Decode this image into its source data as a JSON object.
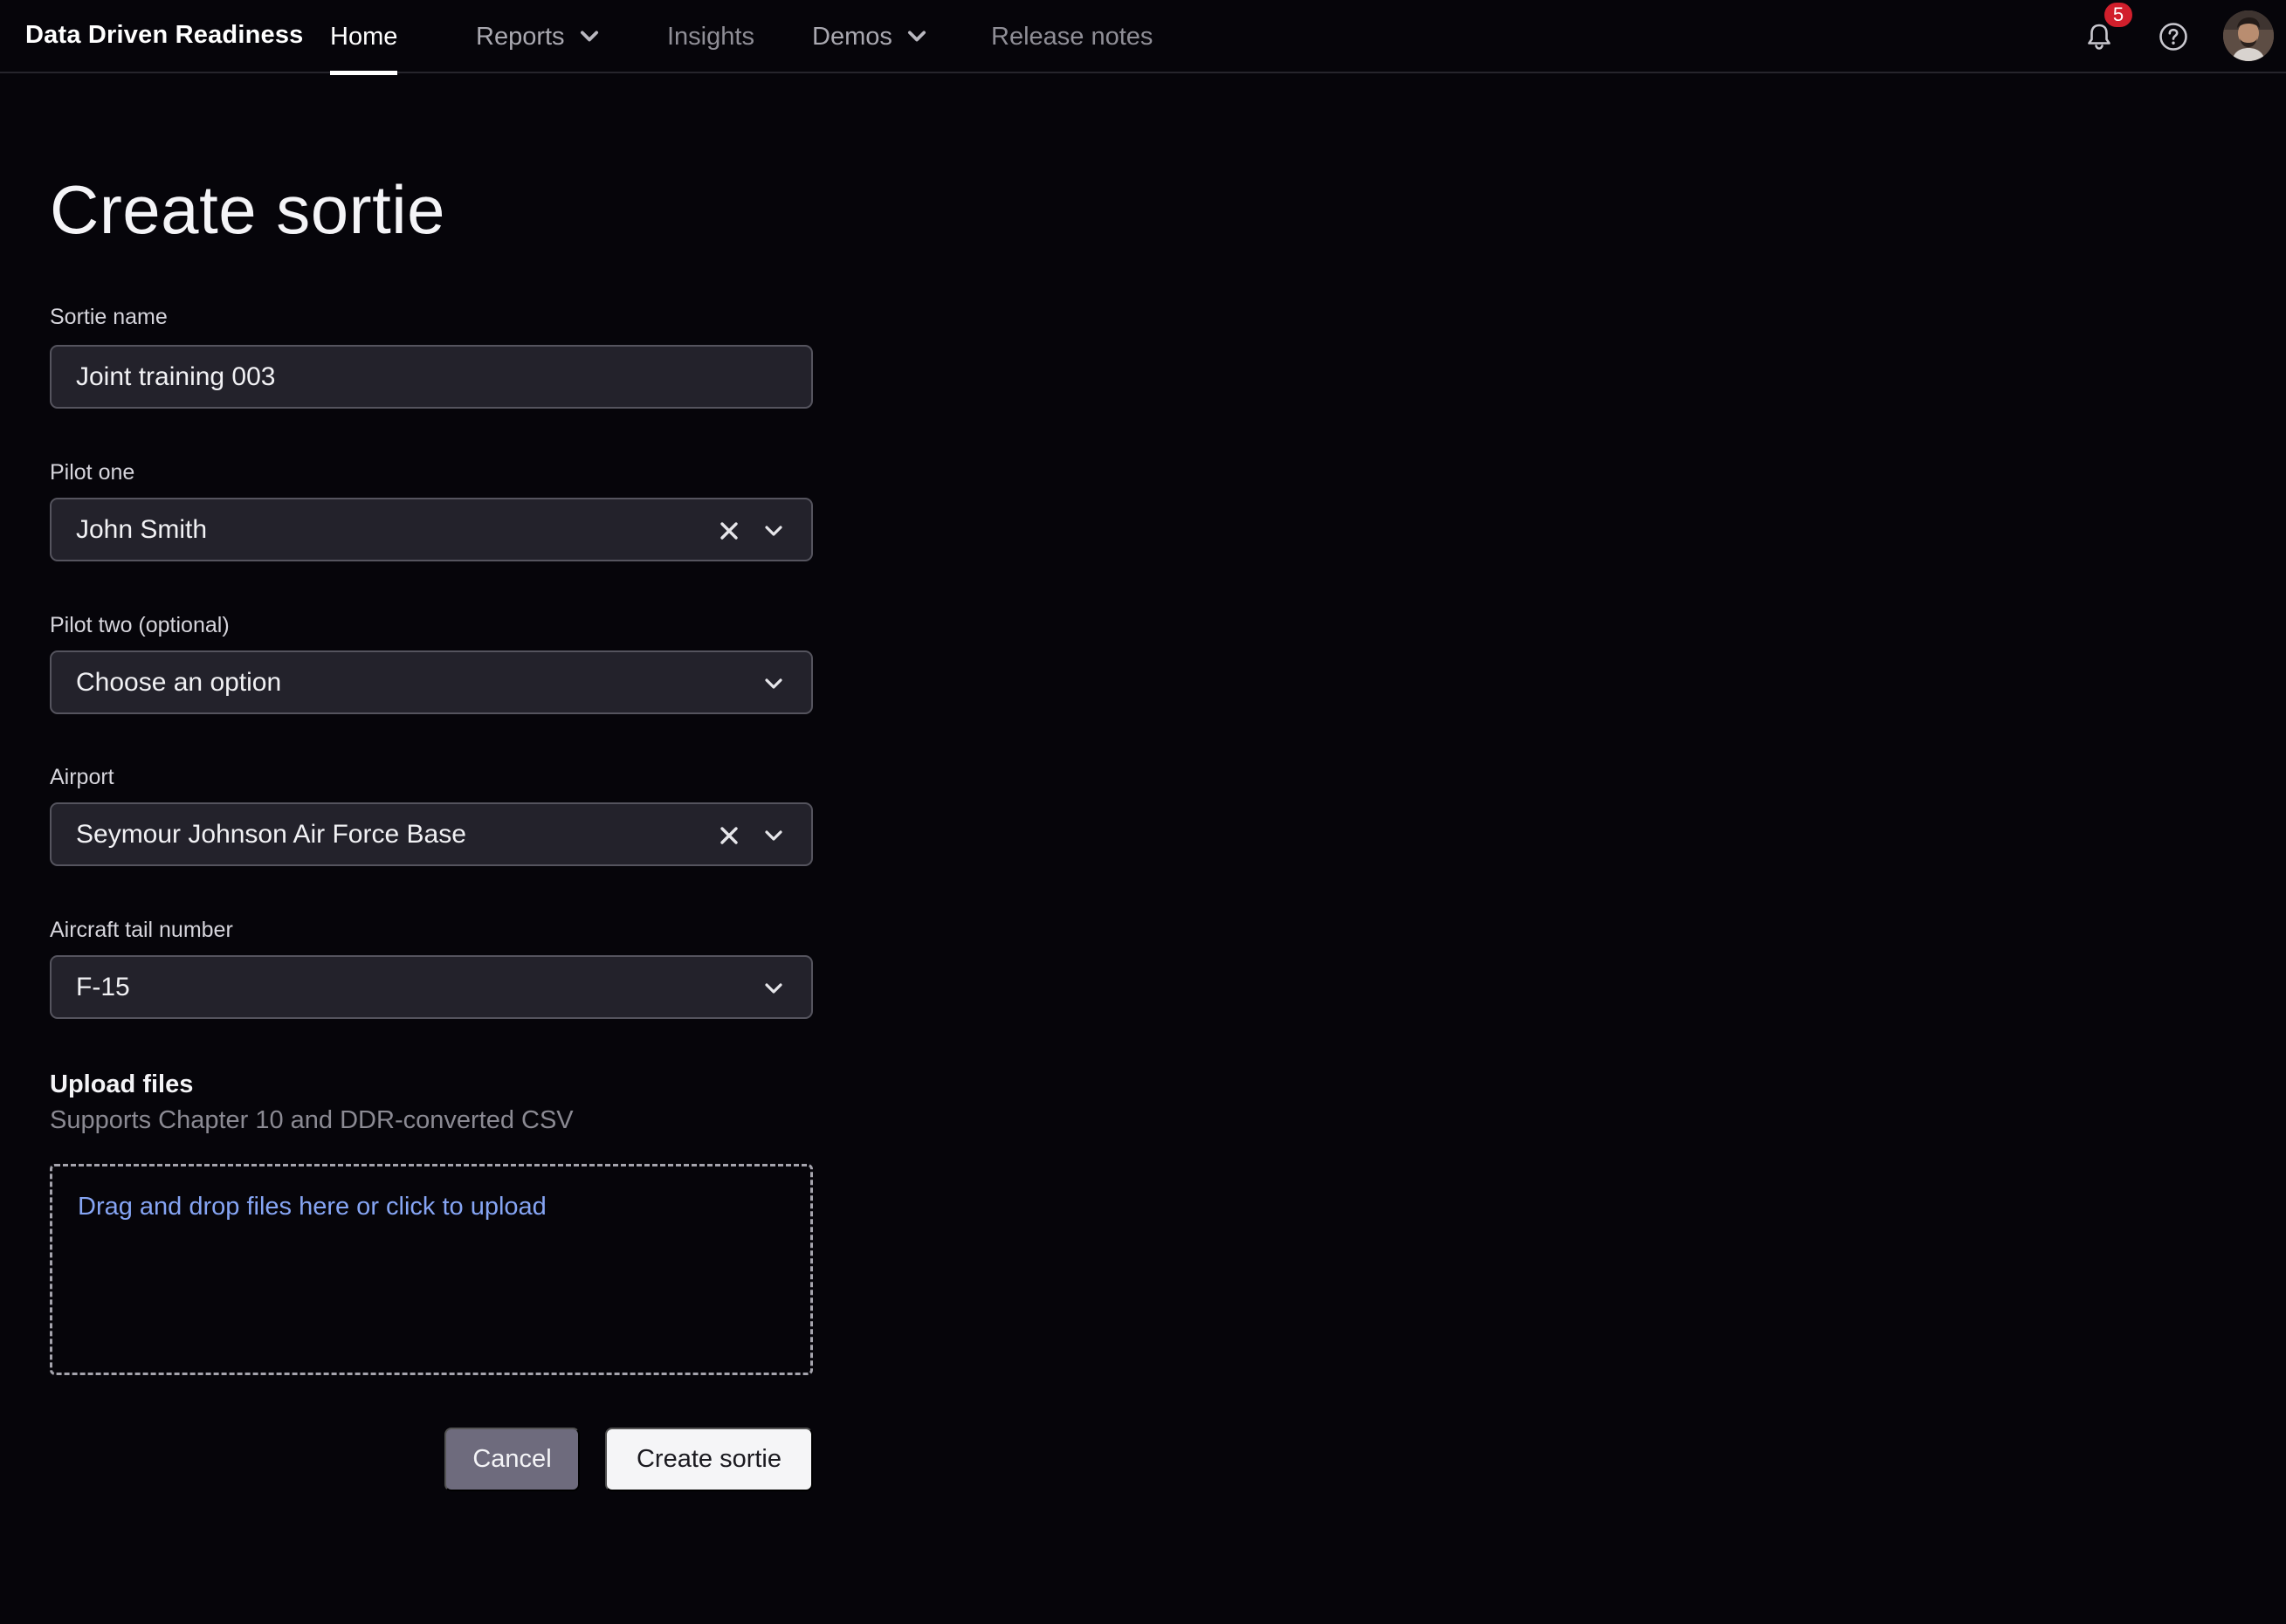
{
  "header": {
    "brand": "Data Driven Readiness",
    "nav": [
      {
        "label": "Home",
        "active": true
      },
      {
        "label": "Reports",
        "has_dropdown": true
      },
      {
        "label": "Insights"
      },
      {
        "label": "Demos",
        "has_dropdown": true
      },
      {
        "label": "Release notes"
      }
    ],
    "notification_count": "5",
    "icons": [
      "bell-icon",
      "help-icon",
      "avatar"
    ]
  },
  "page": {
    "title": "Create sortie"
  },
  "form": {
    "sortie_name": {
      "label": "Sortie name",
      "value": "Joint training 003"
    },
    "pilot_one": {
      "label": "Pilot one",
      "value": "John Smith",
      "clearable": true
    },
    "pilot_two": {
      "label": "Pilot two (optional)",
      "placeholder": "Choose an option"
    },
    "airport": {
      "label": "Airport",
      "value": "Seymour Johnson Air Force Base",
      "clearable": true
    },
    "tail_number": {
      "label": "Aircraft tail number",
      "value": "F-15"
    }
  },
  "upload": {
    "heading": "Upload files",
    "subtitle": "Supports Chapter 10 and DDR-converted CSV",
    "dropzone_text": "Drag and drop files here or click to upload"
  },
  "actions": {
    "cancel_label": "Cancel",
    "create_label": "Create sortie"
  },
  "colors": {
    "background": "#06050a",
    "field_background": "#23222b",
    "link": "#86a5f4",
    "badge": "#d11f2c",
    "cancel_button": "#6e6b7d"
  }
}
